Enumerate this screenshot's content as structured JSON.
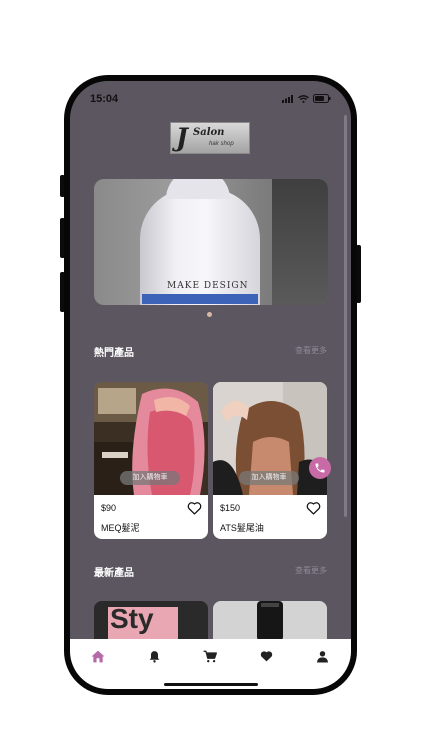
{
  "status_bar": {
    "time": "15:04"
  },
  "logo": {
    "mark": "J",
    "name": "Salon",
    "tagline": "hair shop"
  },
  "banner": {
    "brand_text": "MAKE DESIGN",
    "active_slide": 1,
    "slide_count": 1
  },
  "hot_products": {
    "title": "熱門產品",
    "see_more": "查看更多",
    "items": [
      {
        "price": "$90",
        "name": "MEQ髮泥",
        "cart_label": "加入購物車",
        "favorited": false
      },
      {
        "price": "$150",
        "name": "ATS髮尾油",
        "cart_label": "加入購物車",
        "favorited": false
      }
    ]
  },
  "new_products": {
    "title": "最新產品",
    "see_more": "查看更多",
    "items": [
      {
        "image_text": "Sty"
      },
      {
        "image_text": ""
      }
    ]
  },
  "bottom_nav": {
    "items": [
      {
        "icon": "home-icon",
        "active": true
      },
      {
        "icon": "bell-icon",
        "active": false
      },
      {
        "icon": "cart-icon",
        "active": false
      },
      {
        "icon": "heart-icon",
        "active": false
      },
      {
        "icon": "user-icon",
        "active": false
      }
    ]
  },
  "colors": {
    "background": "#5b5660",
    "accent": "#c86aa6",
    "nav_active": "#b56aa8",
    "nav_inactive": "#222222",
    "see_more": "#8f8a95"
  }
}
